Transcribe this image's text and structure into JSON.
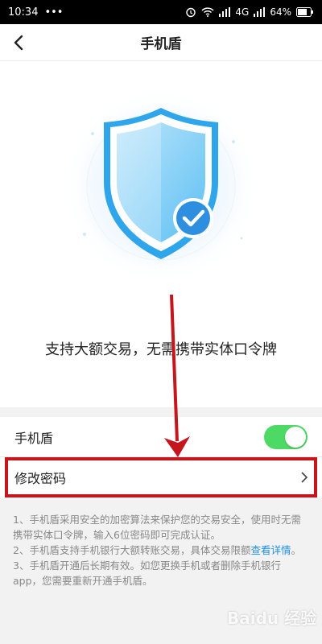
{
  "status_bar": {
    "time": "10:34",
    "dots": "•••",
    "network": "4G",
    "battery": "64%"
  },
  "nav": {
    "title": "手机盾",
    "back_icon": "chevron-left-icon"
  },
  "hero": {
    "tagline": "支持大额交易，无需携带实体口令牌",
    "shield_icon": "shield-check-icon"
  },
  "settings": {
    "toggle_label": "手机盾",
    "toggle_on": true,
    "password_label": "修改密码"
  },
  "notes": [
    {
      "text": "1、手机盾采用安全的加密算法来保护您的交易安全，使用时无需携带实体口令牌，输入6位密码即可完成认证。"
    },
    {
      "text": "2、手机盾支持手机银行大额转账交易，具体交易限额",
      "link": "查看详情",
      "after": "。"
    },
    {
      "text": "3、手机盾开通后长期有效。如您更换手机或者删除手机银行app，您需要重新开通手机盾。"
    }
  ],
  "watermark": "Baidu 经验",
  "colors": {
    "toggle_on": "#4cd964",
    "link": "#1e8fe1",
    "annotation": "#c4161c",
    "shield": "#3ab0f0"
  }
}
